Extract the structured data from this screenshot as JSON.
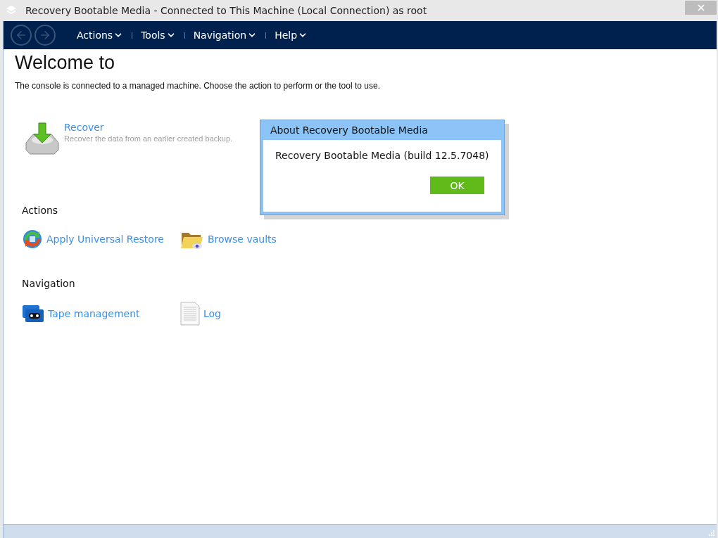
{
  "window": {
    "title": "Recovery Bootable Media - Connected to This Machine (Local Connection) as root"
  },
  "menu": [
    {
      "label": "Actions"
    },
    {
      "label": "Tools"
    },
    {
      "label": "Navigation"
    },
    {
      "label": "Help"
    }
  ],
  "heading": "Welcome to",
  "intro": "The console is connected to a managed machine. Choose the action to perform or the tool to use.",
  "main_action": {
    "label": "Recover",
    "description": "Recover the data from an earlier created backup."
  },
  "sections": [
    {
      "title": "Actions",
      "links": [
        {
          "kind": "restore",
          "label": "Apply Universal Restore"
        },
        {
          "kind": "vault",
          "label": "Browse vaults"
        }
      ]
    },
    {
      "title": "Navigation",
      "links": [
        {
          "kind": "tape",
          "label": "Tape management"
        },
        {
          "kind": "log",
          "label": "Log"
        }
      ]
    }
  ],
  "dialog": {
    "title": "About Recovery Bootable Media",
    "message": "Recovery Bootable Media (build 12.5.7048)",
    "button": "OK"
  }
}
